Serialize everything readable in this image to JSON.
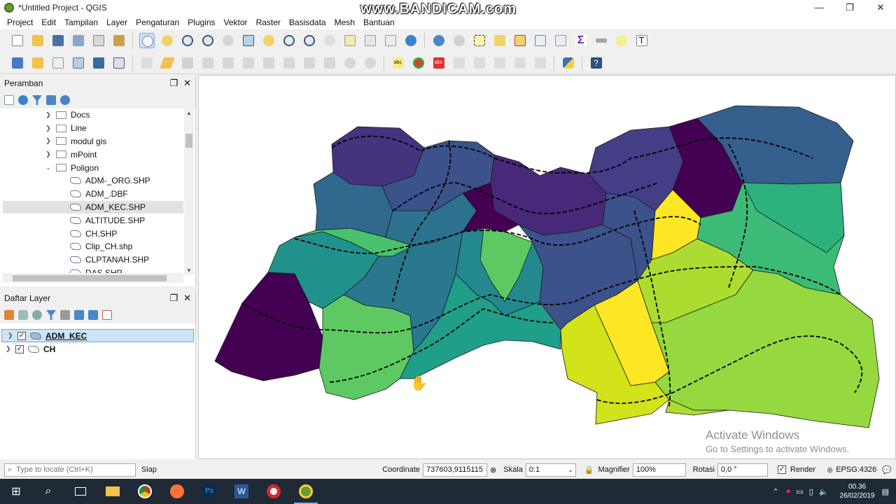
{
  "window": {
    "title": "*Untitled Project - QGIS",
    "watermark": "www.BANDICAM.com",
    "controls": [
      "—",
      "❐",
      "✕"
    ]
  },
  "menu": [
    "Project",
    "Edit",
    "Tampilan",
    "Layer",
    "Pengaturan",
    "Plugins",
    "Vektor",
    "Raster",
    "Basisdata",
    "Mesh",
    "Bantuan"
  ],
  "browser": {
    "title": "Peramban",
    "items": [
      {
        "label": "Docs",
        "type": "folder",
        "expanded": false
      },
      {
        "label": "Line",
        "type": "folder",
        "expanded": false
      },
      {
        "label": "modul gis",
        "type": "folder",
        "expanded": false
      },
      {
        "label": "mPoint",
        "type": "folder",
        "expanded": false
      },
      {
        "label": "Poligon",
        "type": "folder",
        "expanded": true
      },
      {
        "label": "ADM-_ORG.SHP",
        "type": "vector"
      },
      {
        "label": "ADM_.DBF",
        "type": "vector"
      },
      {
        "label": "ADM_KEC.SHP",
        "type": "vector",
        "selected": true
      },
      {
        "label": "ALTITUDE.SHP",
        "type": "vector"
      },
      {
        "label": "CH.SHP",
        "type": "vector"
      },
      {
        "label": "Clip_CH.shp",
        "type": "vector"
      },
      {
        "label": "CLPTANAH.SHP",
        "type": "vector"
      },
      {
        "label": "DAS.SHP",
        "type": "vector"
      }
    ]
  },
  "layers": {
    "title": "Daftar Layer",
    "items": [
      {
        "label": "ADM_KEC",
        "checked": true,
        "selected": true
      },
      {
        "label": "CH",
        "checked": true,
        "selected": false
      }
    ]
  },
  "map": {
    "activate_title": "Activate Windows",
    "activate_sub": "Go to Settings to activate Windows."
  },
  "status": {
    "locate_placeholder": "Type to locate (Ctrl+K)",
    "ready": "Siap",
    "coordinate_label": "Coordinate",
    "coordinate_value": "737603,9115115",
    "scale_label": "Skala",
    "scale_value": "0:1",
    "magnifier_label": "Magnifier",
    "magnifier_value": "100%",
    "rotation_label": "Rotasi",
    "rotation_value": "0,0 °",
    "render_label": "Render",
    "epsg": "EPSG:4326"
  },
  "taskbar": {
    "time": "00.36",
    "date": "26/02/2019"
  },
  "colors": {
    "viridis": [
      "#440154",
      "#3b528b",
      "#21918c",
      "#5ec962",
      "#fde725"
    ]
  }
}
